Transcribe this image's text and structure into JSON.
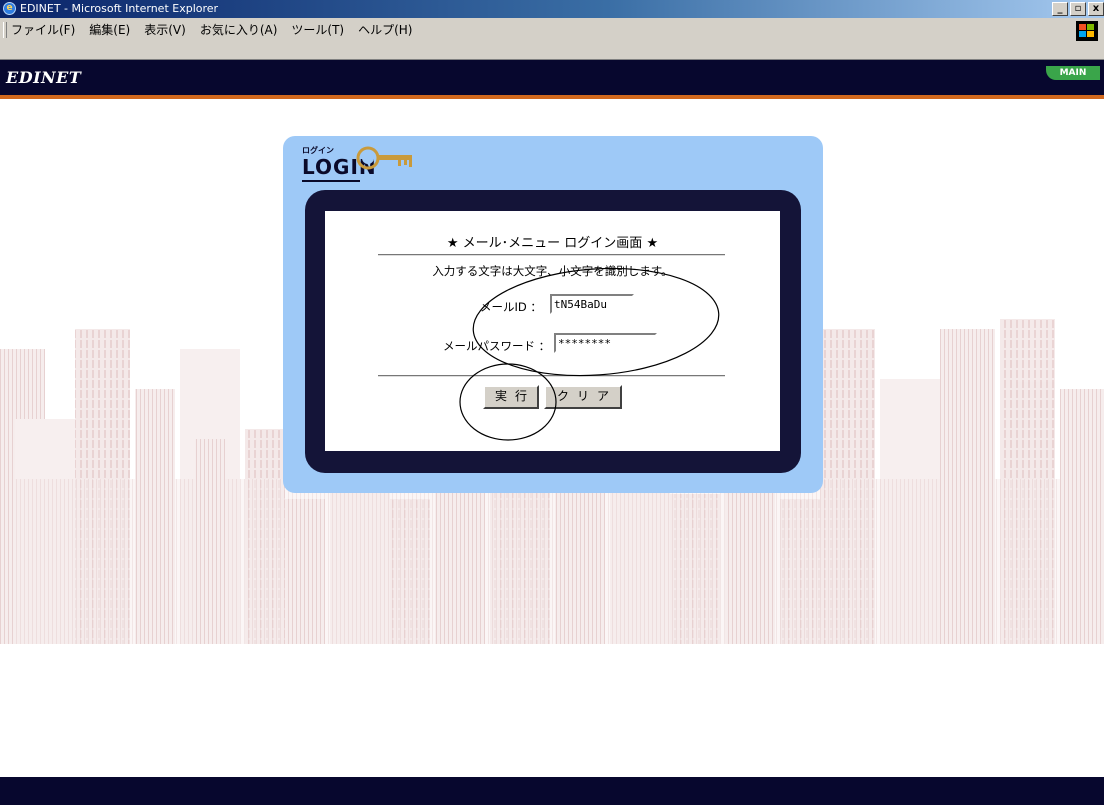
{
  "window": {
    "title": "EDINET - Microsoft Internet Explorer",
    "min_glyph": "_",
    "max_glyph": "▫",
    "close_glyph": "x"
  },
  "menubar": {
    "items": [
      {
        "label": "ファイル(F)"
      },
      {
        "label": "編集(E)"
      },
      {
        "label": "表示(V)"
      },
      {
        "label": "お気に入り(A)"
      },
      {
        "label": "ツール(T)"
      },
      {
        "label": "ヘルプ(H)"
      }
    ]
  },
  "header": {
    "brand": "EDINET",
    "main_tab": "MAIN"
  },
  "login": {
    "logo_kana": "ログイン",
    "logo_text": "LOGIN",
    "title": "★ メール･メニュー ログイン画面 ★",
    "note": "入力する文字は大文字、小文字を識別します。",
    "mail_id_label": "メールID ：",
    "mail_id_value": "tN54BaDu",
    "password_label": "メールパスワード ：",
    "password_value": "********",
    "submit_label": "実行",
    "clear_label": "クリア"
  },
  "colors": {
    "header_bg": "#07072e",
    "header_accent": "#d2691e",
    "card_bg": "#9ec9f7",
    "frame_bg": "#141438",
    "main_tab_bg": "#3aa54a"
  }
}
